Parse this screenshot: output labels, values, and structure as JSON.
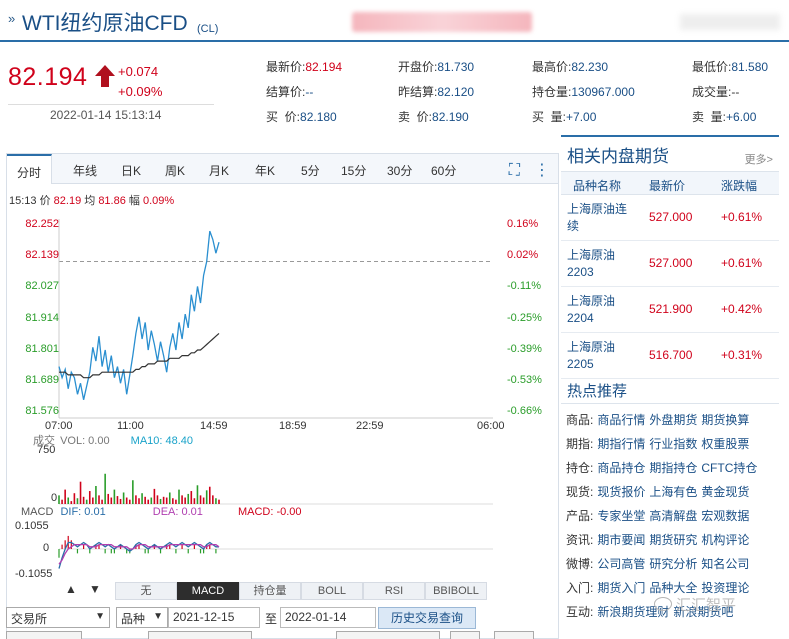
{
  "header": {
    "mark": "»",
    "title": "WTI纽约原油CFD",
    "code": "(CL)"
  },
  "quote": {
    "price": "82.194",
    "change": "+0.074",
    "change_pct": "+0.09%",
    "timestamp": "2022-01-14 15:13:14",
    "rows": [
      [
        {
          "label": "最新价:",
          "value": "82.194",
          "tone": "red"
        },
        {
          "label": "开盘价:",
          "value": "81.730",
          "tone": "blue"
        },
        {
          "label": "最高价:",
          "value": "82.230",
          "tone": "blue"
        },
        {
          "label": "最低价:",
          "value": "81.580",
          "tone": "blue"
        }
      ],
      [
        {
          "label": "结算价:",
          "value": "--",
          "tone": "blue"
        },
        {
          "label": "昨结算:",
          "value": "82.120",
          "tone": "blue"
        },
        {
          "label": "持仓量:",
          "value": "130967.000",
          "tone": "blue"
        },
        {
          "label": "成交量:",
          "value": "--",
          "tone": "dark"
        }
      ],
      [
        {
          "label": "买  价:",
          "value": "82.180",
          "tone": "blue"
        },
        {
          "label": "卖  价:",
          "value": "82.190",
          "tone": "blue"
        },
        {
          "label": "买  量:",
          "value": "+7.00",
          "tone": "blue"
        },
        {
          "label": "卖  量:",
          "value": "+6.00",
          "tone": "blue"
        }
      ]
    ]
  },
  "chart": {
    "tabs": [
      "分时",
      "年线",
      "日K",
      "周K",
      "月K",
      "年K",
      "5分",
      "15分",
      "30分",
      "60分"
    ],
    "active_tab": "分时",
    "info": {
      "time": "15:13",
      "price_label": "价",
      "price": "82.19",
      "avg_label": "均",
      "avg": "81.86",
      "amp_label": "幅",
      "amp": "0.09%"
    },
    "indicators": [
      "无",
      "MACD",
      "持仓量",
      "BOLL",
      "RSI",
      "BBIBOLL"
    ],
    "active_indicator": "MACD",
    "vol_info": {
      "label": "成交",
      "vol": "VOL: 0.00",
      "ma10": "MA10: 48.40"
    },
    "macd_info": {
      "label": "MACD",
      "dif": "DIF: 0.01",
      "dea": "DEA: 0.01",
      "macd": "MACD: -0.00"
    }
  },
  "chart_data": {
    "type": "line",
    "title": "",
    "y_left_ticks": [
      "82.252",
      "82.139",
      "82.027",
      "81.914",
      "81.801",
      "81.689",
      "81.576"
    ],
    "y_right_ticks": [
      "0.16%",
      "0.02%",
      "-0.11%",
      "-0.25%",
      "-0.39%",
      "-0.53%",
      "-0.66%"
    ],
    "x_ticks": [
      "07:00",
      "11:00",
      "14:59",
      "18:59",
      "22:59",
      "06:00"
    ],
    "ylim": [
      81.576,
      82.252
    ],
    "prev_settle": 82.12,
    "series": [
      {
        "name": "价",
        "color": "#2a8fd0",
        "values": [
          81.74,
          81.7,
          81.73,
          81.66,
          81.72,
          81.7,
          81.64,
          81.68,
          81.62,
          81.67,
          81.72,
          81.81,
          81.76,
          81.85,
          81.74,
          81.8,
          81.72,
          81.78,
          81.7,
          81.74,
          81.68,
          81.73,
          81.64,
          81.71,
          81.78,
          81.86,
          81.92,
          81.84,
          81.9,
          81.8,
          81.87,
          81.82,
          81.76,
          81.83,
          81.78,
          81.72,
          81.81,
          81.86,
          81.8,
          81.9,
          81.84,
          81.93,
          81.88,
          82.0,
          81.94,
          82.03,
          81.97,
          82.07,
          82.12,
          82.23,
          82.2,
          82.15,
          82.19
        ]
      },
      {
        "name": "均",
        "color": "#333333",
        "values": [
          81.72,
          81.72,
          81.72,
          81.71,
          81.71,
          81.71,
          81.71,
          81.71,
          81.7,
          81.7,
          81.7,
          81.71,
          81.71,
          81.71,
          81.72,
          81.72,
          81.72,
          81.72,
          81.72,
          81.72,
          81.72,
          81.72,
          81.72,
          81.72,
          81.72,
          81.73,
          81.73,
          81.74,
          81.74,
          81.75,
          81.75,
          81.75,
          81.76,
          81.76,
          81.76,
          81.76,
          81.77,
          81.77,
          81.77,
          81.77,
          81.78,
          81.78,
          81.78,
          81.79,
          81.79,
          81.8,
          81.8,
          81.81,
          81.82,
          81.83,
          81.84,
          81.85,
          81.86
        ]
      }
    ],
    "volume": {
      "ylabels": [
        "750",
        "0"
      ],
      "ylim": [
        0,
        750
      ],
      "values": [
        120,
        60,
        200,
        90,
        40,
        150,
        80,
        310,
        100,
        60,
        180,
        90,
        250,
        120,
        60,
        420,
        140,
        90,
        200,
        110,
        70,
        160,
        90,
        60,
        330,
        120,
        80,
        150,
        100,
        60,
        90,
        210,
        120,
        70,
        100,
        90,
        160,
        80,
        60,
        200,
        120,
        90,
        140,
        180,
        80,
        260,
        120,
        90,
        190,
        240,
        120,
        80,
        60
      ]
    },
    "macd": {
      "ylabels": [
        "0.1055",
        "0",
        "-0.1055"
      ],
      "ylim": [
        -0.1055,
        0.1055
      ],
      "dif": [
        -0.09,
        -0.04,
        0.0,
        0.03,
        0.03,
        0.02,
        0.01,
        0.02,
        0.03,
        0.02,
        0.0,
        0.01,
        0.02,
        0.03,
        0.02,
        0.01,
        0.02,
        0.01,
        0.0,
        0.01,
        0.02,
        0.01,
        0.0,
        -0.01,
        0.0,
        0.02,
        0.03,
        0.02,
        0.01,
        0.0,
        0.01,
        0.02,
        0.01,
        0.0,
        0.01,
        0.02,
        0.03,
        0.02,
        0.01,
        0.02,
        0.03,
        0.02,
        0.01,
        0.02,
        0.03,
        0.02,
        0.01,
        0.0,
        0.02,
        0.03,
        0.02,
        0.01,
        0.01
      ],
      "dea": [
        -0.07,
        -0.05,
        -0.02,
        0.0,
        0.01,
        0.02,
        0.02,
        0.02,
        0.02,
        0.02,
        0.01,
        0.01,
        0.01,
        0.02,
        0.02,
        0.02,
        0.02,
        0.02,
        0.01,
        0.01,
        0.01,
        0.01,
        0.01,
        0.0,
        0.0,
        0.01,
        0.02,
        0.02,
        0.02,
        0.01,
        0.01,
        0.01,
        0.01,
        0.01,
        0.01,
        0.01,
        0.02,
        0.02,
        0.02,
        0.02,
        0.02,
        0.02,
        0.02,
        0.02,
        0.02,
        0.02,
        0.02,
        0.01,
        0.01,
        0.02,
        0.02,
        0.02,
        0.01
      ]
    }
  },
  "form": {
    "exchange": "交易所",
    "variety": "品种",
    "start_date": "2021-12-15",
    "to": "至",
    "end_date": "2022-01-14",
    "history_button": "历史交易查询"
  },
  "side": {
    "title": "相关内盘期货",
    "more": "更多>",
    "columns": [
      "品种名称",
      "最新价",
      "涨跌幅"
    ],
    "rows": [
      {
        "name": "上海原油连续",
        "price": "527.000",
        "change": "+0.61%"
      },
      {
        "name": "上海原油2203",
        "price": "527.000",
        "change": "+0.61%"
      },
      {
        "name": "上海原油2204",
        "price": "521.900",
        "change": "+0.42%"
      },
      {
        "name": "上海原油2205",
        "price": "516.700",
        "change": "+0.31%"
      }
    ],
    "hot_title": "热点推荐",
    "hot": [
      {
        "cat": "商品:",
        "links": [
          "商品行情",
          "外盘期货",
          "期货换算"
        ]
      },
      {
        "cat": "期指:",
        "links": [
          "期指行情",
          "行业指数",
          "权重股票"
        ]
      },
      {
        "cat": "持仓:",
        "links": [
          "商品持仓",
          "期指持仓",
          "CFTC持仓"
        ]
      },
      {
        "cat": "现货:",
        "links": [
          "现货报价",
          "上海有色",
          "黄金现货"
        ]
      },
      {
        "cat": "产品:",
        "links": [
          "专家坐堂",
          "高清解盘",
          "宏观数据"
        ]
      },
      {
        "cat": "资讯:",
        "links": [
          "期市要闻",
          "期货研究",
          "机构评论"
        ]
      },
      {
        "cat": "微博:",
        "links": [
          "公司高管",
          "研究分析",
          "知名公司"
        ]
      },
      {
        "cat": "入门:",
        "links": [
          "期货入门",
          "品种大全",
          "投资理论"
        ]
      },
      {
        "cat": "互动:",
        "links": [
          "新浪期货理财",
          "新浪期货吧"
        ]
      }
    ]
  },
  "watermark": "汇汇智平"
}
